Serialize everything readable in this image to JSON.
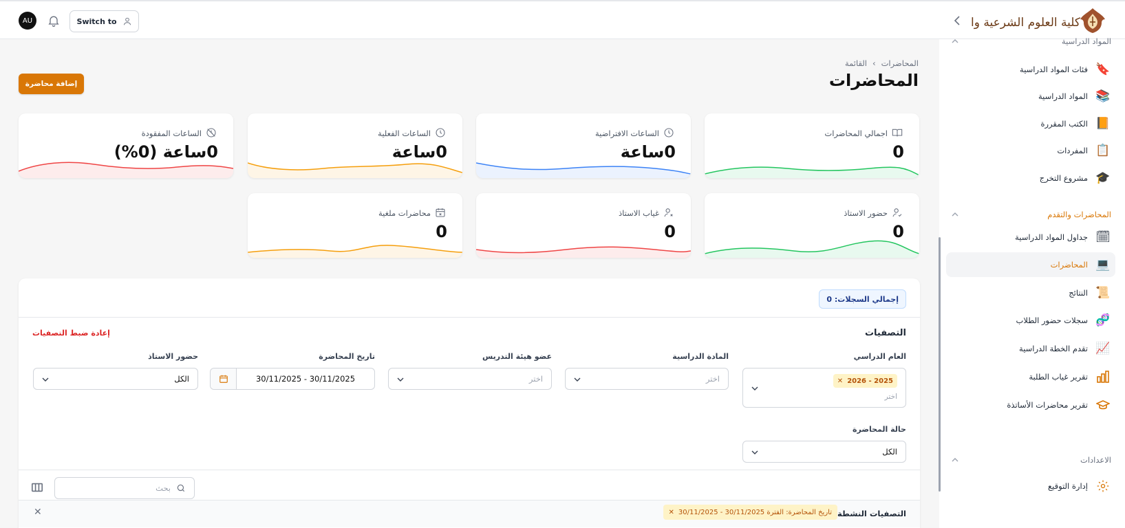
{
  "topbar": {
    "avatar_initials": "AU",
    "switch_label": "Switch to"
  },
  "logo": {
    "text": "كلية العلوم الشرعية والإفتاء"
  },
  "sidebar": {
    "group_top": "المواد الدراسية",
    "items_top": [
      {
        "label": "فئات المواد الدراسية",
        "icon": "bookmark-icon"
      },
      {
        "label": "المواد الدراسية",
        "icon": "books-icon"
      },
      {
        "label": "الكتب المقررة",
        "icon": "book-icon"
      },
      {
        "label": "المفردات",
        "icon": "clipboard-icon"
      },
      {
        "label": "مشروع التخرج",
        "icon": "graduation-cap-icon"
      }
    ],
    "group_lectures": "المحاضرات والتقدم",
    "items_lectures": [
      {
        "label": "جداول المواد الدراسية",
        "icon": "calendar-icon"
      },
      {
        "label": "المحاضرات",
        "icon": "laptop-icon"
      },
      {
        "label": "النتائج",
        "icon": "scroll-icon"
      },
      {
        "label": "سجلات حضور الطلاب",
        "icon": "fingerprint-icon"
      },
      {
        "label": "تقدم الخطة الدراسية",
        "icon": "chart-up-icon"
      },
      {
        "label": "تقرير غياب الطلبة",
        "icon": "bar-chart-icon"
      },
      {
        "label": "تقرير محاضرات الأساتذة",
        "icon": "mortarboard-icon"
      }
    ],
    "group_settings": "الاعدادات",
    "items_settings": [
      {
        "label": "إدارة التوقيع",
        "icon": "gear-icon"
      }
    ]
  },
  "breadcrumb": {
    "first": "المحاضرات",
    "second": "القائمة"
  },
  "page_title": "المحاضرات",
  "add_button": "إضافة محاضرة",
  "stats": [
    {
      "label": "اجمالي المحاضرات",
      "value": "0",
      "color": "#22c55e"
    },
    {
      "label": "الساعات الافتراضية",
      "value": "0ساعة",
      "color": "#3b82f6"
    },
    {
      "label": "الساعات الفعلية",
      "value": "0ساعة",
      "color": "#f59e0b"
    },
    {
      "label": "الساعات المفقودة",
      "value": "0ساعة (0%)",
      "color": "#ef4444"
    },
    {
      "label": "حضور الاستاذ",
      "value": "0",
      "color": "#22c55e"
    },
    {
      "label": "غياب الاستاذ",
      "value": "0",
      "color": "#ef4444"
    },
    {
      "label": "محاضرات ملغية",
      "value": "0",
      "color": "#f59e0b"
    }
  ],
  "panel": {
    "total_records": "إجمالي السجلات: 0",
    "filters_title": "التصفيات",
    "reset_filters": "إعادة ضبط التصفيات",
    "filters": {
      "year": {
        "label": "العام الدراسي",
        "tag": "2025 - 2026",
        "placeholder": "اختر"
      },
      "subject": {
        "label": "المادة الدراسية",
        "placeholder": "اختر"
      },
      "teacher": {
        "label": "عضو هيئة التدريس",
        "placeholder": "اختر"
      },
      "date": {
        "label": "تاريخ المحاضرة",
        "value": "30/11/2025 - 30/11/2025"
      },
      "attendance": {
        "label": "حضور الاستاذ",
        "value": "الكل"
      },
      "status": {
        "label": "حالة المحاضرة",
        "value": "الكل"
      }
    },
    "search_placeholder": "بحث",
    "active_filters_label": "التصفيات النشطة",
    "active_filter_tag": "تاريخ المحاضرة: الفترة 30/11/2025 - 30/11/2025"
  }
}
